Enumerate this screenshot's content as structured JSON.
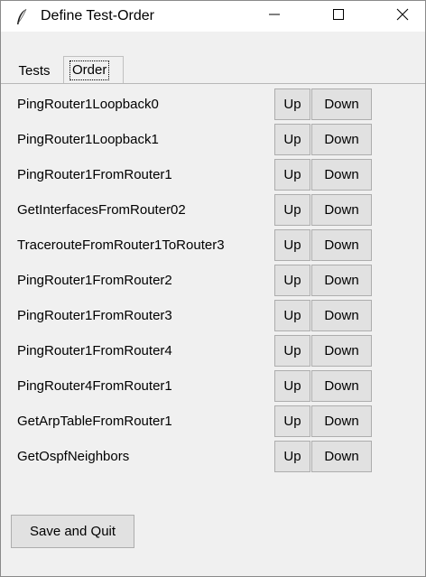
{
  "window": {
    "title": "Define Test-Order",
    "minimize_glyph": "—",
    "maximize_glyph": "☐",
    "close_glyph": "✕"
  },
  "tabs": [
    {
      "label": "Tests",
      "selected": false
    },
    {
      "label": "Order",
      "selected": true
    }
  ],
  "tests": [
    "PingRouter1Loopback0",
    "PingRouter1Loopback1",
    "PingRouter1FromRouter1",
    "GetInterfacesFromRouter02",
    "TracerouteFromRouter1ToRouter3",
    "PingRouter1FromRouter2",
    "PingRouter1FromRouter3",
    "PingRouter1FromRouter4",
    "PingRouter4FromRouter1",
    "GetArpTableFromRouter1",
    "GetOspfNeighbors"
  ],
  "row_buttons": {
    "up_label": "Up",
    "down_label": "Down"
  },
  "save_label": "Save and Quit",
  "icons": {
    "app": "feather-icon",
    "minimize": "minimize-icon",
    "maximize": "maximize-icon",
    "close": "close-icon"
  }
}
